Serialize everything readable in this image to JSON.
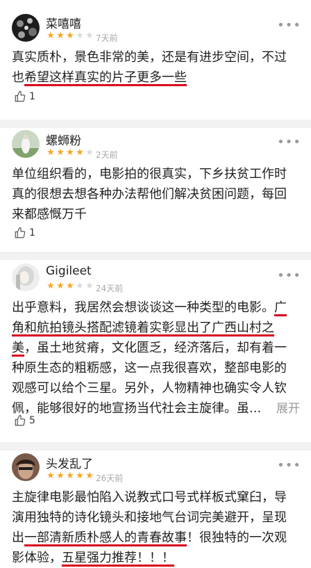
{
  "colors": {
    "star_filled": "#f5a623",
    "star_empty": "#d9d9d9",
    "underline": "#d6001c"
  },
  "reviews": [
    {
      "user": "菜嘻嘻",
      "stars": 3,
      "time": "7天前",
      "lines": [
        [
          {
            "t": "真实质朴，景色非常的美，还是有进步空间，不过"
          }
        ],
        [
          {
            "t": "也"
          },
          {
            "t": "希望这样真实的片子更多一些",
            "u": true
          }
        ]
      ],
      "likes": "1"
    },
    {
      "user": "螺蛳粉",
      "stars": 4,
      "time": "2天前",
      "lines": [
        [
          {
            "t": "单位组织看的，电影拍的很真实，下乡扶贫工作时"
          }
        ],
        [
          {
            "t": "真的很想去想各种办法帮他们解决贫困问题，每回"
          }
        ],
        [
          {
            "t": "来都感慨万千"
          }
        ]
      ],
      "likes": "1"
    },
    {
      "user": "Gigileet",
      "stars": 3,
      "time": "24天前",
      "lines": [
        [
          {
            "t": "出乎意料，我居然会想谈谈这一种类型的电影。"
          },
          {
            "t": "广",
            "u": true
          }
        ],
        [
          {
            "t": "角和航拍镜头搭配滤镜着实彰显出了广西山村之",
            "u": true
          }
        ],
        [
          {
            "t": "美",
            "u": true
          },
          {
            "t": "，虽土地贫瘠，文化匮乏，经济落后，却有着一"
          }
        ],
        [
          {
            "t": "种原生态的粗粝感，这一点我很喜欢，整部电影的"
          }
        ],
        [
          {
            "t": "观感可以给个三星。另外，人物精神也确实令人钦"
          }
        ],
        [
          {
            "t": "佩，能够很好的地宣扬当代社会主旋律。虽..."
          }
        ]
      ],
      "expand": "展开",
      "likes": "5"
    },
    {
      "user": "头发乱了",
      "stars": 5,
      "time": "26天前",
      "lines": [
        [
          {
            "t": "主旋律电影最怕陷入说教式口号式样板式窠臼，导"
          }
        ],
        [
          {
            "t": "演用独特的诗化镜头和接地气台词完美避开，呈现"
          }
        ],
        [
          {
            "t": "出"
          },
          {
            "t": "一部清新质朴感人的青春故事",
            "u": true
          },
          {
            "t": "！很独特的一次观"
          }
        ],
        [
          {
            "t": "影体验，"
          },
          {
            "t": "五星强力推荐！！！",
            "u": true
          }
        ]
      ],
      "likes": ""
    }
  ]
}
